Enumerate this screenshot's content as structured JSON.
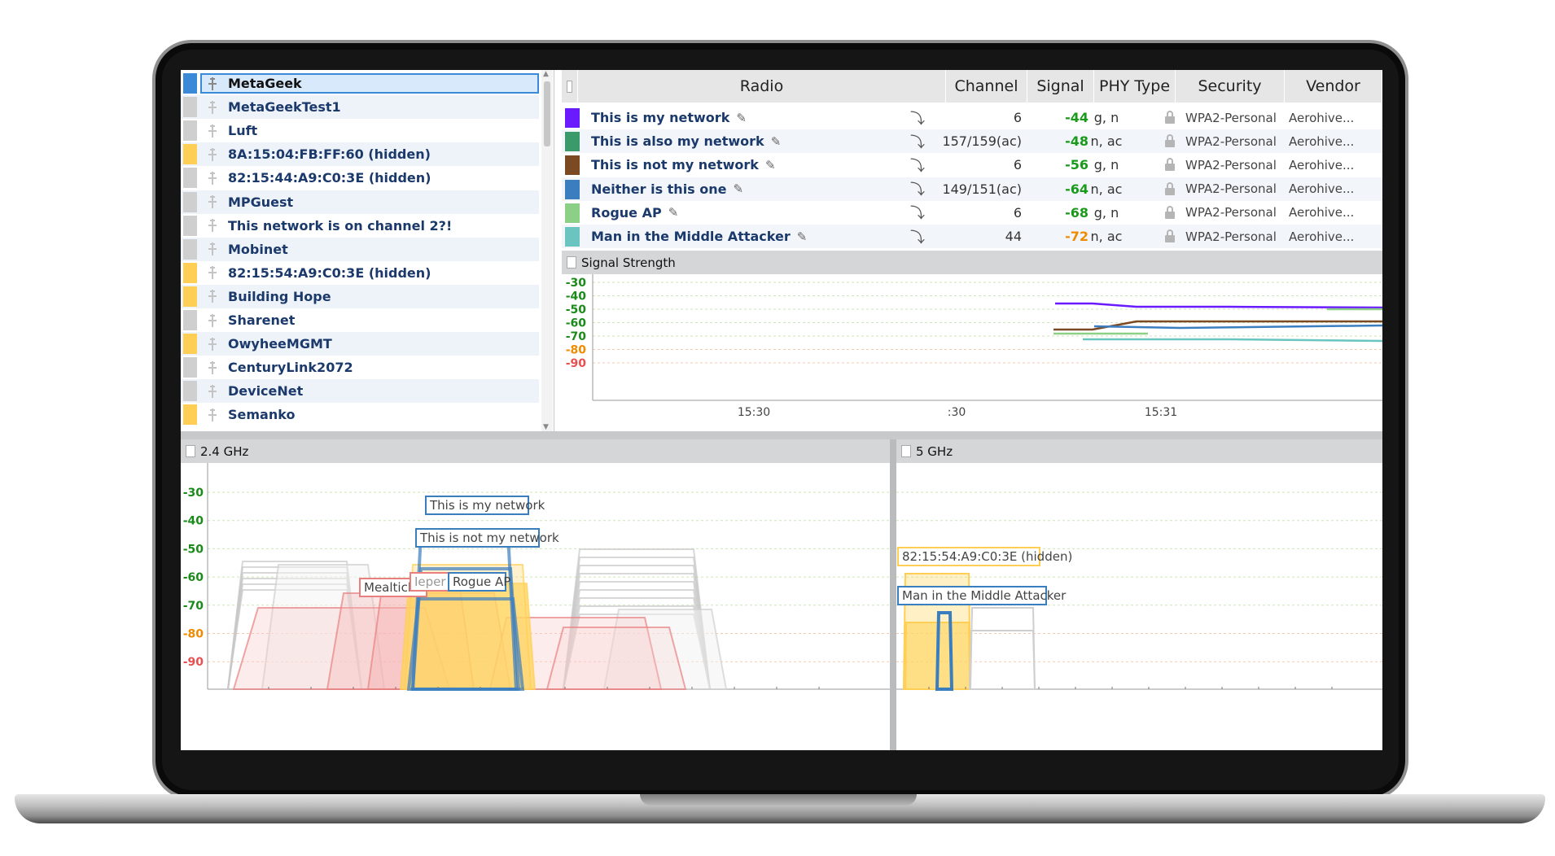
{
  "networks_list": [
    {
      "name": "MetaGeek",
      "color": "#3a8ad8",
      "selected": true
    },
    {
      "name": "MetaGeekTest1",
      "color": "#cfcfcf"
    },
    {
      "name": "Luft",
      "color": "#cfcfcf"
    },
    {
      "name": "8A:15:04:FB:FF:60 (hidden)",
      "color": "#ffcf55"
    },
    {
      "name": "82:15:44:A9:C0:3E (hidden)",
      "color": "#cfcfcf"
    },
    {
      "name": "MPGuest",
      "color": "#cfcfcf"
    },
    {
      "name": "This network is on channel 2?!",
      "color": "#cfcfcf"
    },
    {
      "name": "Mobinet",
      "color": "#cfcfcf"
    },
    {
      "name": "82:15:54:A9:C0:3E (hidden)",
      "color": "#ffcf55"
    },
    {
      "name": "Building Hope",
      "color": "#ffcf55"
    },
    {
      "name": "Sharenet",
      "color": "#cfcfcf"
    },
    {
      "name": "OwyheeMGMT",
      "color": "#ffcf55"
    },
    {
      "name": "CenturyLink2072",
      "color": "#cfcfcf"
    },
    {
      "name": "DeviceNet",
      "color": "#cfcfcf"
    },
    {
      "name": "Semanko",
      "color": "#ffcf55"
    }
  ],
  "radio_table": {
    "headers": {
      "radio": "Radio",
      "channel": "Channel",
      "signal": "Signal",
      "phy": "PHY Type",
      "security": "Security",
      "vendor": "Vendor"
    },
    "rows": [
      {
        "name": "This is my network",
        "color": "#6a1aff",
        "channel": "6",
        "signal": "-44",
        "signal_color": "#1a9a1a",
        "phy": "g, n",
        "security": "WPA2-Personal",
        "vendor": "Aerohive..."
      },
      {
        "name": "This is also my network",
        "color": "#3a9a6a",
        "channel": "157/159(ac)",
        "signal": "-48",
        "signal_color": "#1a9a1a",
        "phy": "n, ac",
        "security": "WPA2-Personal",
        "vendor": "Aerohive..."
      },
      {
        "name": "This is not my network",
        "color": "#7b4a22",
        "channel": "6",
        "signal": "-56",
        "signal_color": "#1a9a1a",
        "phy": "g, n",
        "security": "WPA2-Personal",
        "vendor": "Aerohive..."
      },
      {
        "name": "Neither is this one",
        "color": "#3a7ec0",
        "channel": "149/151(ac)",
        "signal": "-64",
        "signal_color": "#1a9a1a",
        "phy": "n, ac",
        "security": "WPA2-Personal",
        "vendor": "Aerohive..."
      },
      {
        "name": "Rogue AP",
        "color": "#8ccf86",
        "channel": "6",
        "signal": "-68",
        "signal_color": "#1a9a1a",
        "phy": "g, n",
        "security": "WPA2-Personal",
        "vendor": "Aerohive..."
      },
      {
        "name": "Man in the Middle Attacker",
        "color": "#6ac4c0",
        "channel": "44",
        "signal": "-72",
        "signal_color": "#f08a00",
        "phy": "n, ac",
        "security": "WPA2-Personal",
        "vendor": "Aerohive..."
      }
    ]
  },
  "signal_strength": {
    "title": "Signal Strength",
    "y_ticks": [
      "-30",
      "-40",
      "-50",
      "-60",
      "-70",
      "-80",
      "-90"
    ],
    "x_ticks": [
      "15:30",
      ":30",
      "15:31"
    ]
  },
  "band_24": {
    "title": "2.4 GHz",
    "y_ticks": [
      "-30",
      "-40",
      "-50",
      "-60",
      "-70",
      "-80",
      "-90"
    ],
    "labels": {
      "my": "This is my network",
      "notmy": "This is not my network",
      "rogue": "Rogue AP",
      "mealtick": "Mealtick",
      "ieper": "Ieper"
    }
  },
  "band_5": {
    "title": "5 GHz",
    "labels": {
      "hidden": "82:15:54:A9:C0:3E (hidden)",
      "mitm": "Man in the Middle Attacker"
    }
  },
  "tick_colors": {
    "-30": "#1a8a1a",
    "-40": "#1a8a1a",
    "-50": "#1a8a1a",
    "-60": "#1a8a1a",
    "-70": "#1a8a1a",
    "-80": "#f08a00",
    "-90": "#e85050"
  }
}
